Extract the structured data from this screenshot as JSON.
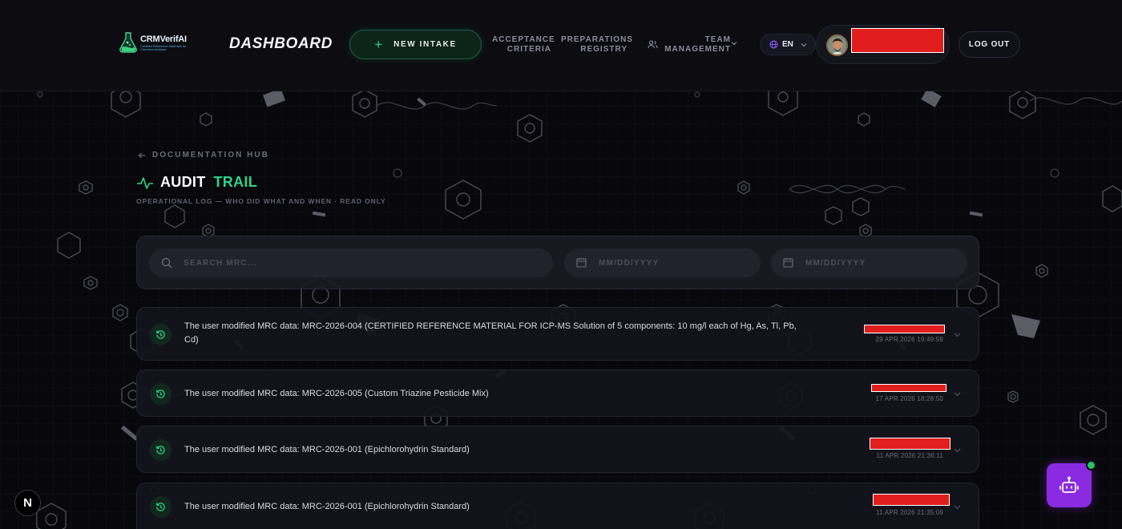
{
  "header": {
    "logo_brand": "CRMVerifAI",
    "logo_tagline": "Certified Reference Materials for Chemical Analysis",
    "page_title": "DASHBOARD",
    "new_intake_label": "NEW INTAKE",
    "nav": {
      "acceptance": [
        "ACCEPTANCE",
        "CRITERIA"
      ],
      "preparations": [
        "PREPARATIONS",
        "REGISTRY"
      ],
      "team": [
        "TEAM",
        "MANAGEMENT"
      ]
    },
    "language": "EN",
    "logout_label": "LOG OUT"
  },
  "breadcrumb": "DOCUMENTATION HUB",
  "title_part1": "AUDIT",
  "title_part2": "TRAIL",
  "subtitle": "OPERATIONAL LOG — WHO DID WHAT AND WHEN · READ ONLY",
  "filters": {
    "search_placeholder": "SEARCH MRC...",
    "date_from_placeholder": "MM/DD/YYYY",
    "date_to_placeholder": "MM/DD/YYYY"
  },
  "entries": [
    {
      "message": "The user modified MRC data: MRC-2026-004 (CERTIFIED REFERENCE MATERIAL FOR ICP-MS Solution of 5 components: 10 mg/l each of Hg, As, Tl, Pb, Cd)",
      "timestamp": "29 APR 2026 19:49:59"
    },
    {
      "message": "The user modified MRC data: MRC-2026-005 (Custom Triazine Pesticide Mix)",
      "timestamp": "17 APR 2026 18:28:50"
    },
    {
      "message": "The user modified MRC data: MRC-2026-001 (Epichlorohydrin Standard)",
      "timestamp": "11 APR 2026 21:36:11"
    },
    {
      "message": "The user modified MRC data: MRC-2026-001 (Epichlorohydrin Standard)",
      "timestamp": "11 APR 2026 21:35:09"
    }
  ],
  "framework_badge": "N",
  "colors": {
    "accent_green": "#2dd38a",
    "redaction": "#e11d1d",
    "assistant_purple": "#8a2be2",
    "online_dot": "#22c55e"
  }
}
